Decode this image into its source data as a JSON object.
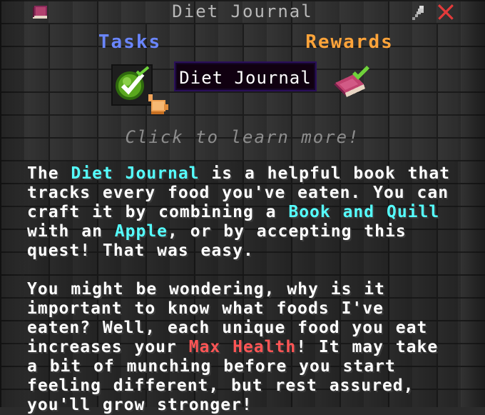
{
  "window": {
    "title": "Diet Journal",
    "icons": {
      "book": "book-icon",
      "pin": "pin-icon",
      "close": "close-icon"
    }
  },
  "tabs": {
    "tasks_label": "Tasks",
    "rewards_label": "Rewards",
    "tasks_color": "#6a86ff",
    "rewards_color": "#ffa43a"
  },
  "task_item": {
    "icon": "check-icon"
  },
  "reward_item": {
    "icon": "diet-journal-book-icon"
  },
  "tooltip": {
    "text": "Diet Journal"
  },
  "hint": {
    "text": "Click to learn more!"
  },
  "description": {
    "p1": {
      "t1": "The ",
      "h1": "Diet Journal",
      "t2": " is a helpful book that tracks every food you've eaten. You can craft it by combining a ",
      "h2": "Book and Quill",
      "t3": " with an ",
      "h3": "Apple",
      "t4": ", or by accepting this quest! That was easy."
    },
    "p2": {
      "t1": "You might be wondering, why is it important to know what foods I've eaten? Well, each unique food you eat increases your ",
      "h1": "Max Health",
      "t2": "! It may take a bit of munching before you start feeling different, but rest assured, you'll grow stronger!"
    },
    "highlight_color": "#55ffff",
    "health_color": "#ff5555"
  }
}
